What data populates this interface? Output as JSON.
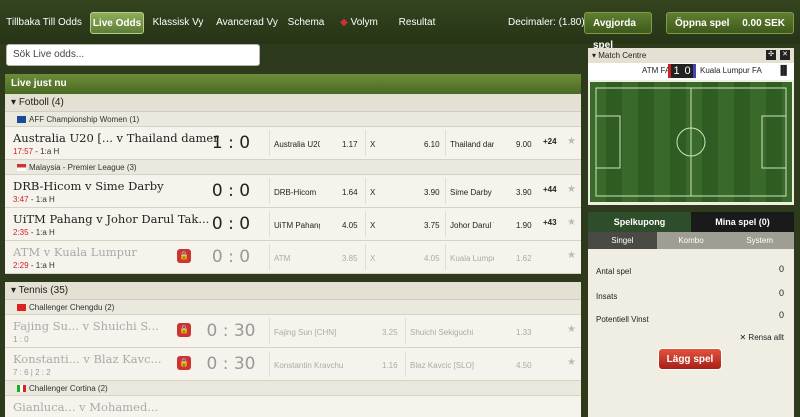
{
  "nav": {
    "back": "Tillbaka Till Odds",
    "live": "Live Odds",
    "classic": "Klassisk Vy",
    "advanced": "Avancerad Vy",
    "schedule": "Schema",
    "volume": "Volym",
    "results": "Resultat",
    "decimal": "Decimaler: (1.80)",
    "settled": "Avgjorda spel",
    "open": "Öppna spel",
    "balance": "0.00 SEK"
  },
  "search": {
    "placeholder": "Sök Live odds..."
  },
  "live_header": "Live just nu",
  "football": {
    "name": "Fotboll (4)",
    "leagues": [
      {
        "name": "AFF Championship Women (1)"
      },
      {
        "name": "Malaysia - Premier League (3)"
      }
    ],
    "matches": [
      {
        "teams": "Australia U20 [... v Thailand damer",
        "time": "17:57",
        "half": "- 1:a H",
        "score": "1 : 0",
        "h": "Australia U20",
        "ho": "1.17",
        "x": "X",
        "xo": "6.10",
        "a": "Thailand dam",
        "ao": "9.00",
        "more": "+24"
      },
      {
        "teams": "DRB-Hicom v Sime Darby",
        "time": "3:47",
        "half": "- 1:a H",
        "score": "0 : 0",
        "h": "DRB-Hicom",
        "ho": "1.64",
        "x": "X",
        "xo": "3.90",
        "a": "Sime Darby",
        "ao": "3.90",
        "more": "+44"
      },
      {
        "teams": "UiTM Pahang v Johor Darul Tak...",
        "time": "2:35",
        "half": "- 1:a H",
        "score": "0 : 0",
        "h": "UiTM Pahang",
        "ho": "4.05",
        "x": "X",
        "xo": "3.75",
        "a": "Johor Darul T",
        "ao": "1.90",
        "more": "+43"
      },
      {
        "teams": "ATM v Kuala Lumpur",
        "time": "2:29",
        "half": "- 1:a H",
        "score": "0 : 0",
        "h": "ATM",
        "ho": "3.85",
        "x": "X",
        "xo": "4.05",
        "a": "Kuala Lumpu",
        "ao": "1.62",
        "more": ""
      }
    ]
  },
  "tennis": {
    "name": "Tennis (35)",
    "leagues": [
      {
        "name": "Challenger Chengdu (2)"
      },
      {
        "name": "Challenger Cortina (2)"
      }
    ],
    "matches": [
      {
        "teams": "Fajing Su... v Shuichi S...",
        "sets": "1 : 0",
        "score": "0 : 30",
        "h": "Fajing Sun [CHN]",
        "ho": "3.25",
        "a": "Shuichi Sekiguchi",
        "ao": "1.33"
      },
      {
        "teams": "Konstanti... v Blaz Kavc...",
        "sets": "7 : 6 | 2 : 2",
        "score": "0 : 30",
        "h": "Konstantin Kravchu",
        "ho": "1.16",
        "a": "Blaz Kavcic [SLO]",
        "ao": "4.50"
      },
      {
        "teams": "Gianluca... v Mohamed..."
      }
    ]
  },
  "match_centre": {
    "title": "Match Centre",
    "home": "ATM FA",
    "home_score": "1",
    "away_score": "0",
    "away": "Kuala Lumpur FA"
  },
  "slip": {
    "tab1": "Spelkupong",
    "tab2": "Mina spel (0)",
    "sub1": "Singel",
    "sub2": "Kombo",
    "sub3": "System",
    "count_label": "Antal spel",
    "count": "0",
    "stake_label": "Insats",
    "stake": "0",
    "win_label": "Potentiell Vinst",
    "win": "0",
    "clear": "Rensa allt",
    "place": "Lägg spel"
  }
}
